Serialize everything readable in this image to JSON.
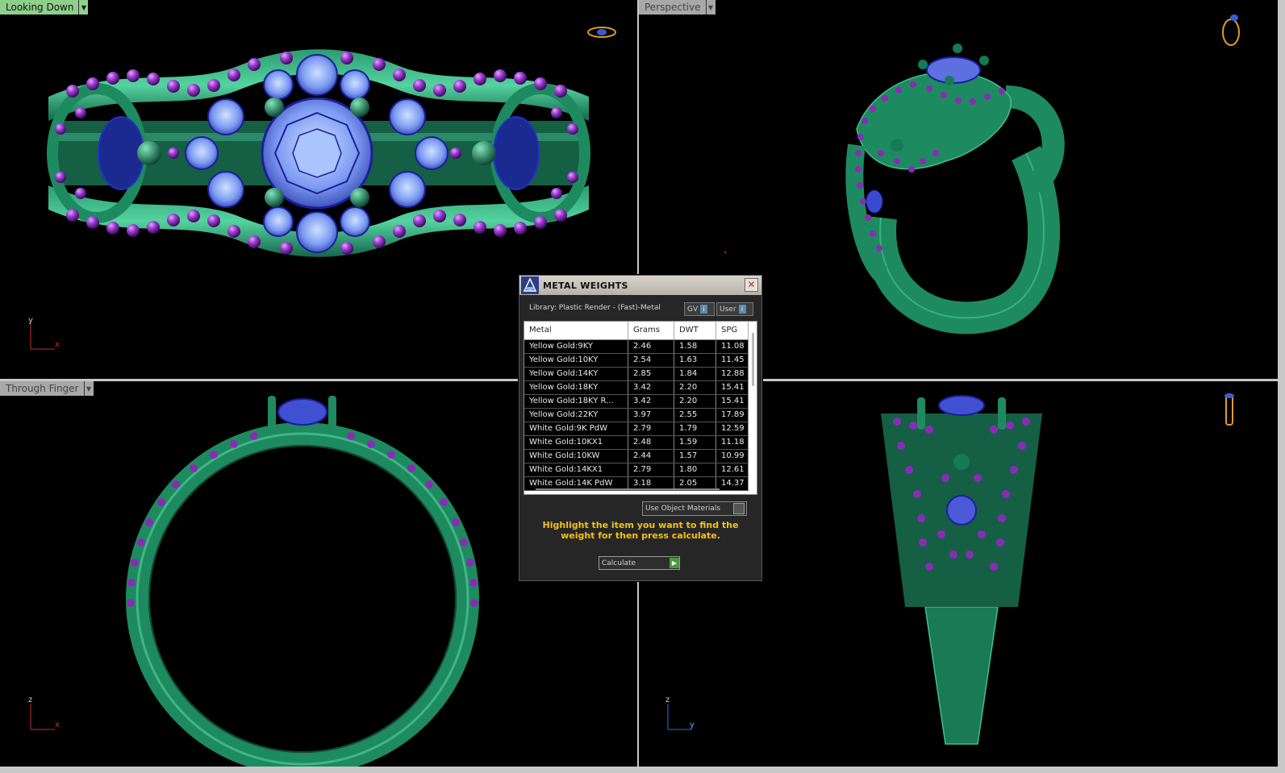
{
  "viewports": {
    "top_left": {
      "label": "Looking Down",
      "axis": {
        "vertical": "y",
        "horizontal": "x"
      }
    },
    "top_right": {
      "label": "Perspective"
    },
    "bottom_left": {
      "label": "Through Finger",
      "axis": {
        "vertical": "z",
        "horizontal": "x"
      }
    },
    "bottom_right": {
      "axis": {
        "vertical": "z",
        "horizontal": "y"
      }
    }
  },
  "colors": {
    "metal": "#1e8a5f",
    "metal_light": "#3fc08c",
    "bead": "#8a2bb8",
    "stone": "#6a8ff0",
    "stone_edge": "#1b1f9a",
    "label_active": "#8fcf8c",
    "hint_text": "#f2c21b"
  },
  "dialog": {
    "title": "METAL WEIGHTS",
    "library": "Library: Plastic Render - (Fast)-Metal",
    "gv_label": "GV",
    "user_label": "User",
    "columns": [
      "Metal",
      "Grams",
      "DWT",
      "SPG"
    ],
    "rows": [
      [
        "Yellow Gold:9KY",
        "2.46",
        "1.58",
        "11.08"
      ],
      [
        "Yellow Gold:10KY",
        "2.54",
        "1.63",
        "11.45"
      ],
      [
        "Yellow Gold:14KY",
        "2.85",
        "1.84",
        "12.88"
      ],
      [
        "Yellow Gold:18KY",
        "3.42",
        "2.20",
        "15.41"
      ],
      [
        "Yellow Gold:18KY R...",
        "3.42",
        "2.20",
        "15.41"
      ],
      [
        "Yellow Gold:22KY",
        "3.97",
        "2.55",
        "17.89"
      ],
      [
        "White Gold:9K PdW",
        "2.79",
        "1.79",
        "12.59"
      ],
      [
        "White Gold:10KX1",
        "2.48",
        "1.59",
        "11.18"
      ],
      [
        "White Gold:10KW",
        "2.44",
        "1.57",
        "10.99"
      ],
      [
        "White Gold:14KX1",
        "2.79",
        "1.80",
        "12.61"
      ],
      [
        "White Gold:14K PdW",
        "3.18",
        "2.05",
        "14.37"
      ]
    ],
    "material_select": "Use Object Materials",
    "hint": "Highlight the item you want to find the weight for then press calculate.",
    "calculate_label": "Calculate"
  }
}
